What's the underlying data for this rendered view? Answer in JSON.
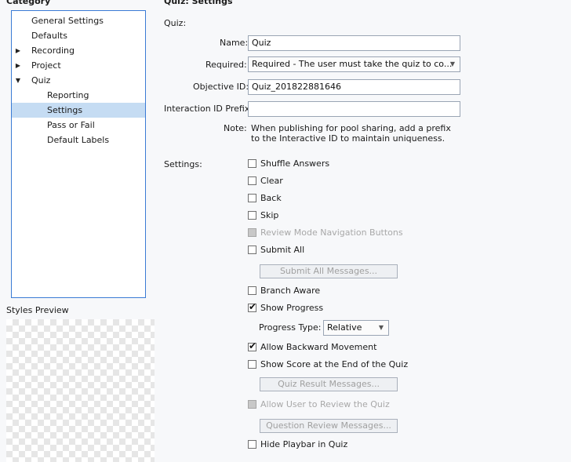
{
  "category_header": "Category",
  "section_header": "Quiz: Settings",
  "tree": [
    {
      "label": "General Settings",
      "indent": 1,
      "arrow": "",
      "selected": false
    },
    {
      "label": "Defaults",
      "indent": 1,
      "arrow": "",
      "selected": false
    },
    {
      "label": "Recording",
      "indent": 1,
      "arrow": "▶",
      "selected": false
    },
    {
      "label": "Project",
      "indent": 1,
      "arrow": "▶",
      "selected": false
    },
    {
      "label": "Quiz",
      "indent": 1,
      "arrow": "▼",
      "selected": false
    },
    {
      "label": "Reporting",
      "indent": 2,
      "arrow": "",
      "selected": false
    },
    {
      "label": "Settings",
      "indent": 2,
      "arrow": "",
      "selected": true
    },
    {
      "label": "Pass or Fail",
      "indent": 2,
      "arrow": "",
      "selected": false
    },
    {
      "label": "Default Labels",
      "indent": 2,
      "arrow": "",
      "selected": false
    }
  ],
  "styles_preview_label": "Styles Preview",
  "quiz_label": "Quiz:",
  "form": {
    "name_label": "Name:",
    "name_value": "Quiz",
    "required_label": "Required:",
    "required_value": "Required - The user must take the quiz to co...",
    "objective_label": "Objective ID:",
    "objective_value": "Quiz_201822881646",
    "interaction_label": "Interaction ID Prefix:",
    "interaction_value": "",
    "note_label": "Note:",
    "note_line1": "When publishing for pool sharing, add a prefix",
    "note_line2": "to the Interactive ID to maintain uniqueness."
  },
  "settings_label": "Settings:",
  "checkboxes": {
    "shuffle": {
      "label": "Shuffle Answers",
      "checked": false,
      "disabled": false
    },
    "clear": {
      "label": "Clear",
      "checked": false,
      "disabled": false
    },
    "back": {
      "label": "Back",
      "checked": false,
      "disabled": false
    },
    "skip": {
      "label": "Skip",
      "checked": false,
      "disabled": false
    },
    "review_nav": {
      "label": "Review Mode Navigation Buttons",
      "checked": false,
      "disabled": true
    },
    "submit_all": {
      "label": "Submit All",
      "checked": false,
      "disabled": false
    },
    "branch_aware": {
      "label": "Branch Aware",
      "checked": false,
      "disabled": false
    },
    "show_progress": {
      "label": "Show Progress",
      "checked": true,
      "disabled": false
    },
    "backward": {
      "label": "Allow Backward Movement",
      "checked": true,
      "disabled": false
    },
    "show_score": {
      "label": "Show Score at the End of the Quiz",
      "checked": false,
      "disabled": false
    },
    "allow_review": {
      "label": "Allow User to Review the Quiz",
      "checked": false,
      "disabled": true
    },
    "hide_playbar": {
      "label": "Hide Playbar in Quiz",
      "checked": false,
      "disabled": false
    }
  },
  "buttons": {
    "submit_all_messages": "Submit All Messages...",
    "quiz_result_messages": "Quiz Result Messages...",
    "question_review_messages": "Question Review Messages..."
  },
  "progress_type": {
    "label": "Progress Type:",
    "value": "Relative"
  }
}
